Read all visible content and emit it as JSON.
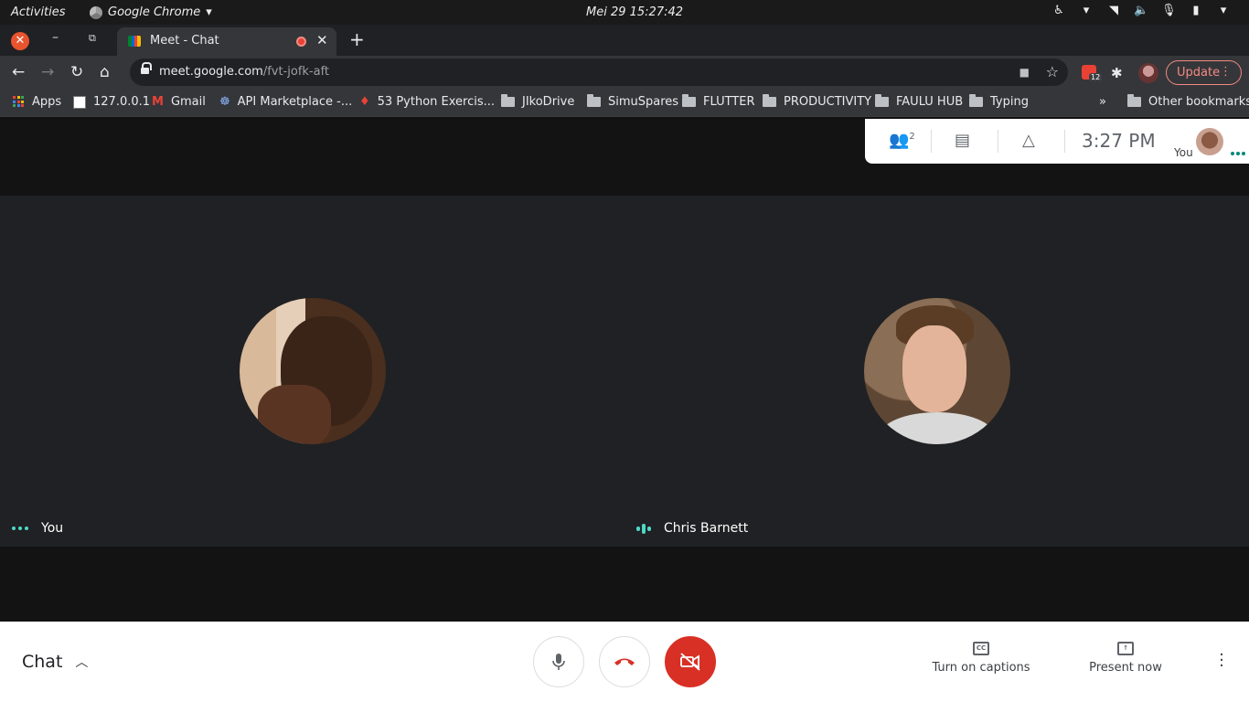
{
  "system_bar": {
    "activities": "Activities",
    "app_name": "Google Chrome",
    "clock": "Mei 29  15:27:42"
  },
  "browser": {
    "tab_title": "Meet - Chat",
    "url_host": "meet.google.com",
    "url_path": "/fvt-jofk-aft",
    "extension_badge": "12",
    "update_label": "Update",
    "bookmarks": [
      {
        "label": "Apps",
        "icon": "apps-grid-icon"
      },
      {
        "label": "127.0.0.1",
        "icon": "page-icon"
      },
      {
        "label": "Gmail",
        "icon": "gmail-icon"
      },
      {
        "label": "API Marketplace -...",
        "icon": "api-icon"
      },
      {
        "label": "53 Python Exercis...",
        "icon": "ruby-icon"
      },
      {
        "label": "JIkoDrive",
        "icon": "folder-icon"
      },
      {
        "label": "SimuSpares",
        "icon": "folder-icon"
      },
      {
        "label": "FLUTTER",
        "icon": "folder-icon"
      },
      {
        "label": "PRODUCTIVITY",
        "icon": "folder-icon"
      },
      {
        "label": "FAULU HUB",
        "icon": "folder-icon"
      },
      {
        "label": "Typing",
        "icon": "folder-icon"
      }
    ],
    "overflow": "»",
    "other_bookmarks": "Other bookmarks"
  },
  "meet": {
    "info_bar": {
      "participant_count": "2",
      "time": "3:27  PM",
      "self_label": "You"
    },
    "tiles": [
      {
        "name": "You",
        "status": "dots"
      },
      {
        "name": "Chris Barnett",
        "status": "speaking"
      }
    ],
    "controls": {
      "chat_label": "Chat",
      "captions_label": "Turn on captions",
      "present_label": "Present now"
    }
  },
  "colors": {
    "hangup_red": "#d93025",
    "accent_teal": "#4dd9c5",
    "update_pink": "#f28b82"
  }
}
